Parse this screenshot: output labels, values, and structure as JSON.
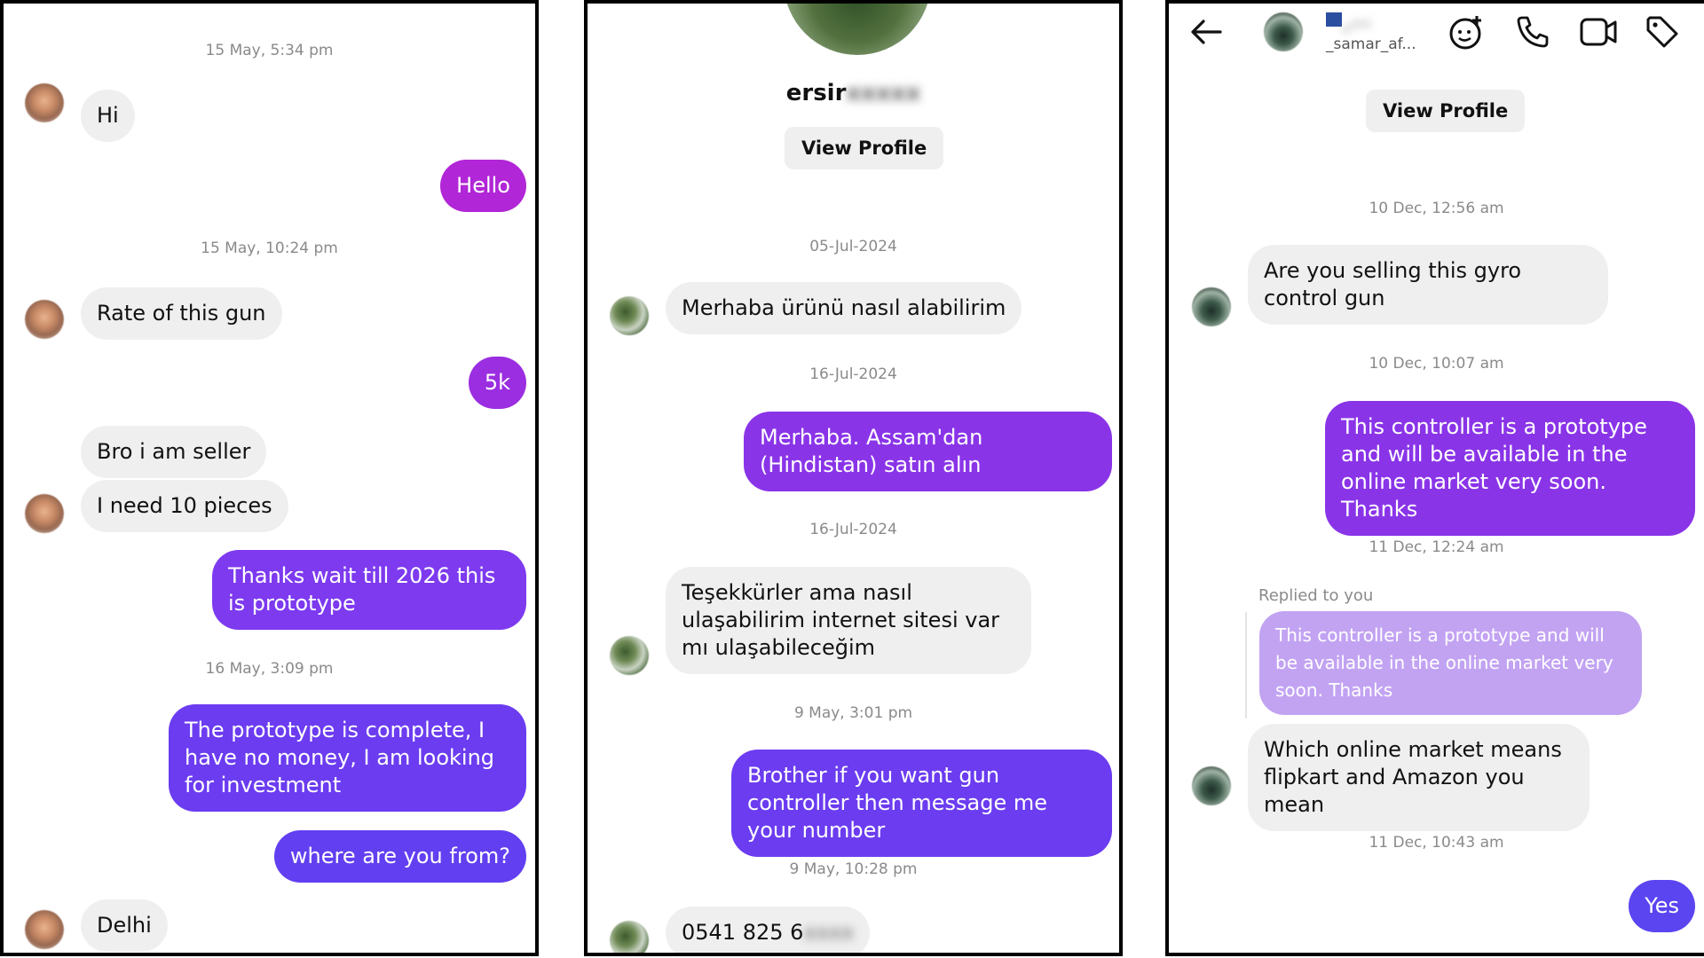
{
  "panel1": {
    "timestamps": [
      "15 May, 5:34 pm",
      "15 May, 10:24 pm",
      "16 May, 3:09 pm"
    ],
    "messages": [
      {
        "dir": "in",
        "text": "Hi"
      },
      {
        "dir": "out",
        "text": "Hello"
      },
      {
        "dir": "in",
        "text": "Rate of this gun"
      },
      {
        "dir": "out",
        "text": "5k"
      },
      {
        "dir": "in",
        "text": "Bro i am seller"
      },
      {
        "dir": "in",
        "text": "I need 10 pieces"
      },
      {
        "dir": "out",
        "text": "Thanks wait till 2026 this is prototype"
      },
      {
        "dir": "out",
        "text": "The prototype is complete, I have no money, I am looking for investment"
      },
      {
        "dir": "out",
        "text": "where are you from?"
      },
      {
        "dir": "in",
        "text": "Delhi"
      }
    ]
  },
  "panel2": {
    "profile_name_visible": "ersir",
    "profile_name_hidden": "xxxxx",
    "view_profile": "View Profile",
    "timestamps": [
      "05-Jul-2024",
      "16-Jul-2024",
      "16-Jul-2024",
      "9 May, 3:01 pm",
      "9 May, 10:28 pm"
    ],
    "messages": [
      {
        "dir": "in",
        "text": "Merhaba ürünü nasıl alabilirim"
      },
      {
        "dir": "out",
        "text": "Merhaba. Assam'dan (Hindistan) satın alın"
      },
      {
        "dir": "in",
        "text": "Teşekkürler ama nasıl ulaşabilirim internet sitesi var mı ulaşabileceğim"
      },
      {
        "dir": "out",
        "text": "Brother if you want gun controller then message me your number"
      },
      {
        "dir": "in",
        "text": "0541 825 6",
        "hidden": "xxxx"
      }
    ]
  },
  "panel3": {
    "header": {
      "name": "_...",
      "username": "_samar_af...",
      "back_icon": "arrow-left-icon",
      "icons": [
        "sticker-add-icon",
        "phone-icon",
        "video-icon",
        "tag-icon"
      ]
    },
    "view_profile": "View Profile",
    "timestamps": [
      "10 Dec, 12:56 am",
      "10 Dec, 10:07 am",
      "11 Dec, 12:24 am",
      "11 Dec, 10:43 am"
    ],
    "replied_label": "Replied to you",
    "messages": [
      {
        "dir": "in",
        "text": "Are you selling this gyro control gun"
      },
      {
        "dir": "out",
        "text": "This controller is a prototype and will be available in the online market very soon. Thanks"
      },
      {
        "dir": "quote",
        "text": "This controller is a prototype and will be available in the online market very soon. Thanks"
      },
      {
        "dir": "in",
        "text": "Which online market means flipkart and Amazon you mean"
      },
      {
        "dir": "out",
        "text": "Yes"
      }
    ]
  },
  "colors": {
    "incoming_bg": "#efefef",
    "outgoing_magenta": "#b126d6",
    "outgoing_purple": "#8a34e8",
    "outgoing_indigo": "#6b3cf0",
    "quote_bg": "#c2a3f2",
    "timestamp": "#8a8a8a"
  }
}
